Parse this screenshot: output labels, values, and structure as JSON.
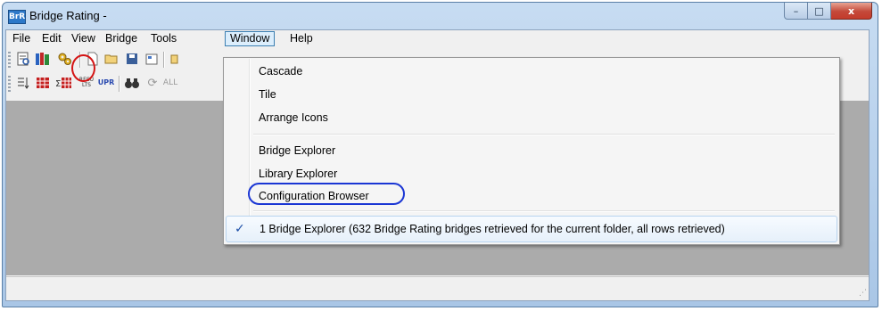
{
  "window": {
    "title": "Bridge Rating -",
    "app_icon_text": "BrR",
    "controls": {
      "minimize": "–",
      "maximize": "□",
      "close": "x"
    }
  },
  "menubar": {
    "items": [
      {
        "label": "File"
      },
      {
        "label": "Edit"
      },
      {
        "label": "View"
      },
      {
        "label": "Bridge"
      },
      {
        "label": "Tools"
      },
      {
        "label": "Window"
      },
      {
        "label": "Help"
      }
    ],
    "open_menu": "Window"
  },
  "toolbar1": {
    "icons": [
      "report-icon",
      "library-icon",
      "configuration-gears-icon",
      "new-file-icon",
      "open-folder-icon",
      "save-icon",
      "properties-icon"
    ]
  },
  "toolbar2": {
    "icons": [
      "sort-list-icon",
      "table-grid-icon",
      "sum-table-icon",
      "results-icon",
      "upr-icon",
      "binoculars-find-icon",
      "refresh-icon",
      "all-icon"
    ],
    "labels": {
      "results": "RESU\nLTS",
      "upr": "UPR",
      "all": "ALL"
    }
  },
  "window_menu": {
    "items": [
      {
        "label": "Cascade"
      },
      {
        "label": "Tile"
      },
      {
        "label": "Arrange Icons"
      },
      {
        "label": "Bridge Explorer"
      },
      {
        "label": "Library Explorer"
      },
      {
        "label": "Configuration Browser"
      },
      {
        "label": "1 Bridge Explorer (632 Bridge Rating bridges retrieved for the current folder, all rows retrieved)",
        "checked": true
      }
    ]
  },
  "colors": {
    "highlight_red": "#d41414",
    "highlight_blue": "#1a36d4",
    "mdi_background": "#ababab"
  }
}
